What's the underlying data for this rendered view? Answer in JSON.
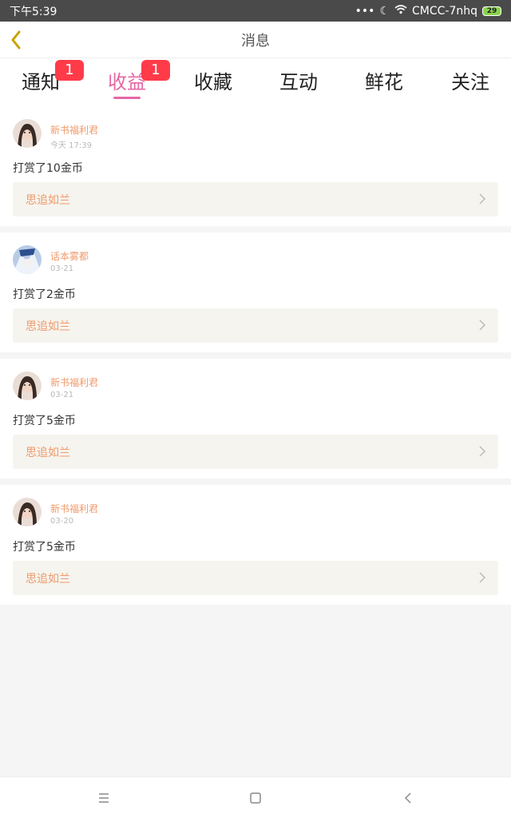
{
  "status_bar": {
    "time": "下午5:39",
    "carrier": "CMCC-7nhq",
    "battery": "29"
  },
  "header": {
    "title": "消息"
  },
  "tabs": [
    {
      "label": "通知",
      "badge": "1"
    },
    {
      "label": "收益",
      "badge": "1"
    },
    {
      "label": "收藏"
    },
    {
      "label": "互动"
    },
    {
      "label": "鲜花"
    },
    {
      "label": "关注"
    }
  ],
  "messages": [
    {
      "name": "新书福利君",
      "time": "今天 17:39",
      "action": "打赏了10金币",
      "book": "思追如兰"
    },
    {
      "name": "话本雾都",
      "time": "03-21",
      "action": "打赏了2金币",
      "book": "思追如兰"
    },
    {
      "name": "新书福利君",
      "time": "03-21",
      "action": "打赏了5金币",
      "book": "思追如兰"
    },
    {
      "name": "新书福利君",
      "time": "03-20",
      "action": "打赏了5金币",
      "book": "思追如兰"
    }
  ],
  "colors": {
    "accent": "#e667a6",
    "badge": "#ff3b4a",
    "name": "#f09a6b",
    "card_book_bg": "#f5f4ee",
    "back_arrow": "#c8a200"
  },
  "icons": {
    "back": "back-arrow-icon",
    "book_chevron": "chevron-right-icon",
    "nav_menu": "menu-icon",
    "nav_home": "home-icon",
    "nav_back": "back-icon"
  }
}
